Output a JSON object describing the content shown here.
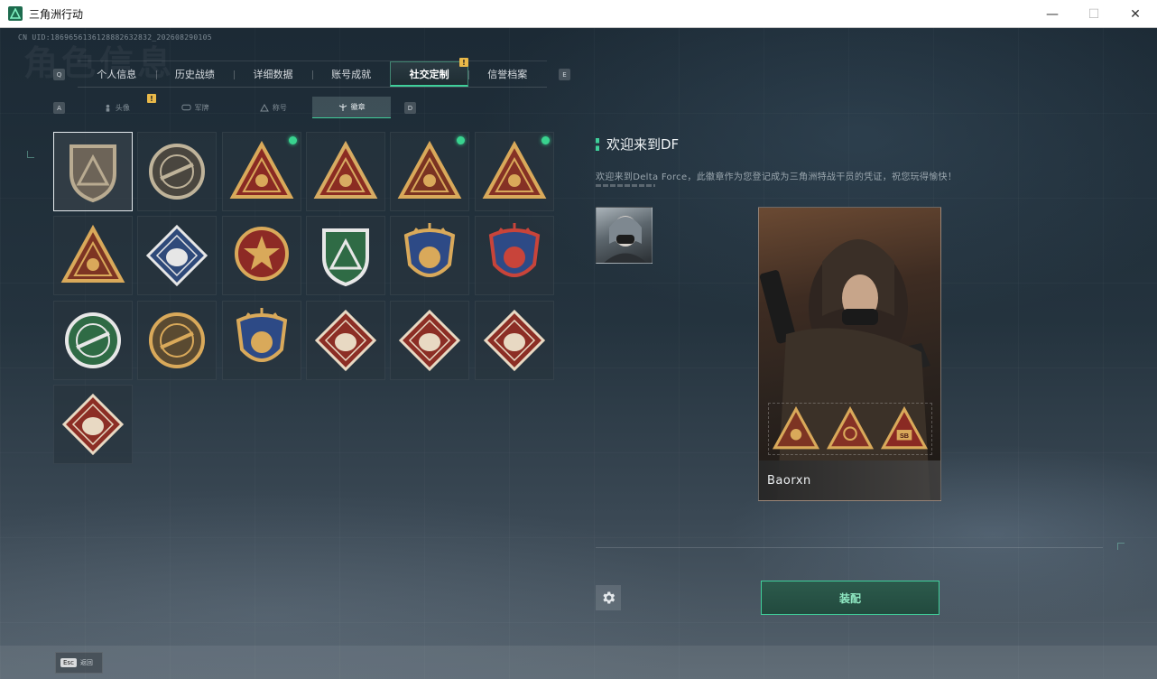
{
  "window": {
    "title": "三角洲行动",
    "controls": {
      "minimize": "—",
      "maximize": "☐",
      "close": "✕"
    }
  },
  "uid": "CN UID:1869656136128882632832_202608290105",
  "background_title": "角色信息",
  "tabs": {
    "prev_key": "Q",
    "next_key": "E",
    "items": [
      {
        "label": "个人信息",
        "active": false
      },
      {
        "label": "历史战绩",
        "active": false
      },
      {
        "label": "详细数据",
        "active": false
      },
      {
        "label": "账号成就",
        "active": false
      },
      {
        "label": "社交定制",
        "active": true,
        "badge": "!"
      },
      {
        "label": "信誉档案",
        "active": false
      }
    ]
  },
  "subtabs": {
    "prev_key": "A",
    "next_key": "D",
    "items": [
      {
        "label": "头像",
        "icon": "person-icon",
        "badge": "!"
      },
      {
        "label": "军牌",
        "icon": "dogtag-icon"
      },
      {
        "label": "称号",
        "icon": "title-icon"
      },
      {
        "label": "徽章",
        "icon": "badge-icon",
        "active": true
      }
    ]
  },
  "badges": [
    {
      "name": "delta-logo-badge",
      "selected": true,
      "new": false,
      "shape": "shield",
      "color": "#6d6458",
      "accent": "#b9ab91"
    },
    {
      "name": "helicopter-badge",
      "selected": false,
      "new": false,
      "shape": "circle",
      "color": "#4a463f",
      "accent": "#bfb39a"
    },
    {
      "name": "sb-triangle-badge",
      "selected": false,
      "new": true,
      "shape": "triangle",
      "color": "#8a2a23",
      "accent": "#d9a95a"
    },
    {
      "name": "number-one-badge",
      "selected": false,
      "new": false,
      "shape": "triangle",
      "color": "#8b2c22",
      "accent": "#d7ab62"
    },
    {
      "name": "soldier-triangle-badge",
      "selected": false,
      "new": true,
      "shape": "triangle",
      "color": "#7a3322",
      "accent": "#d9a95a"
    },
    {
      "name": "lotus-triangle-badge",
      "selected": false,
      "new": true,
      "shape": "triangle",
      "color": "#853125",
      "accent": "#d9a95a"
    },
    {
      "name": "squad-triangle-badge",
      "selected": false,
      "new": false,
      "shape": "triangle",
      "color": "#7d3423",
      "accent": "#d9a95a"
    },
    {
      "name": "rose-diamond-badge",
      "selected": false,
      "new": false,
      "shape": "diamond",
      "color": "#2f4a7a",
      "accent": "#e6e6e6"
    },
    {
      "name": "star-medal-badge",
      "selected": false,
      "new": false,
      "shape": "medal",
      "color": "#8d2a25",
      "accent": "#d9a95a"
    },
    {
      "name": "green-shield-badge",
      "selected": false,
      "new": false,
      "shape": "shield",
      "color": "#2f6b45",
      "accent": "#e7e7e7"
    },
    {
      "name": "blue-crest-badge",
      "selected": false,
      "new": false,
      "shape": "crest",
      "color": "#2d4a86",
      "accent": "#d9a95a"
    },
    {
      "name": "blue-crest-diamond-badge",
      "selected": false,
      "new": false,
      "shape": "crest",
      "color": "#2d4a86",
      "accent": "#c8443a"
    },
    {
      "name": "green-rifle-emblem-badge",
      "selected": false,
      "new": false,
      "shape": "circle",
      "color": "#2f6b45",
      "accent": "#e7e7e7"
    },
    {
      "name": "gold-rifle-emblem-badge",
      "selected": false,
      "new": false,
      "shape": "circle",
      "color": "#5a4a31",
      "accent": "#d9a95a"
    },
    {
      "name": "blue-rifle-crest-badge",
      "selected": false,
      "new": false,
      "shape": "crest",
      "color": "#2d4a86",
      "accent": "#d9a95a"
    },
    {
      "name": "wolf-diamond-badge-1",
      "selected": false,
      "new": false,
      "shape": "diamond",
      "color": "#8c2e25",
      "accent": "#e8d9c3"
    },
    {
      "name": "wolf-diamond-badge-2",
      "selected": false,
      "new": false,
      "shape": "diamond",
      "color": "#8c2e25",
      "accent": "#e8d9c3"
    },
    {
      "name": "dragon-diamond-badge",
      "selected": false,
      "new": false,
      "shape": "diamond",
      "color": "#8c2e25",
      "accent": "#e8d9c3"
    },
    {
      "name": "runner-diamond-badge",
      "selected": false,
      "new": false,
      "shape": "diamond",
      "color": "#8c2e25",
      "accent": "#e8d9c3"
    }
  ],
  "detail": {
    "title": "欢迎来到DF",
    "description": "欢迎来到Delta Force，此徽章作为您登记成为三角洲特战干员的凭证，祝您玩得愉快！"
  },
  "card": {
    "player_name": "Baorxn",
    "sb_label": "SB"
  },
  "actions": {
    "equip_label": "装配",
    "esc_key": "Esc",
    "esc_label": "返回"
  },
  "colors": {
    "accent_green": "#3fcf9a",
    "new_dot": "#39d38f",
    "warn_badge": "#e9b949"
  }
}
